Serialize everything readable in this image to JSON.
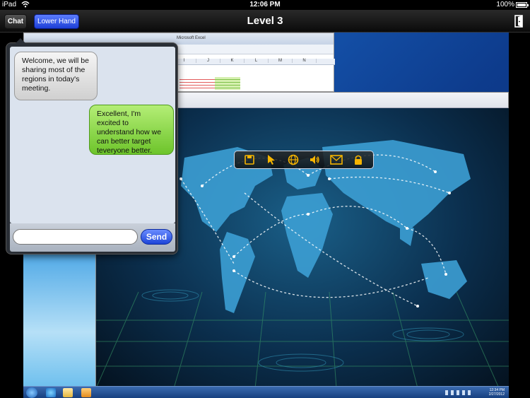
{
  "status_bar": {
    "carrier": "iPad",
    "wifi_icon": "wifi-icon",
    "time": "12:06 PM",
    "battery": "100%"
  },
  "navbar": {
    "chat_label": "Chat",
    "lower_hand_label": "Lower Hand",
    "title": "Level 3",
    "exit_icon": "exit-door-icon"
  },
  "shared_screen": {
    "excel_title": "Microsoft Excel",
    "excel_columns": [
      "I",
      "J",
      "K",
      "L",
      "M",
      "N"
    ],
    "toolbar_icons": [
      "save-icon",
      "pointer-icon",
      "globe-icon",
      "speaker-icon",
      "mail-icon",
      "lock-icon"
    ],
    "taskbar_clock_time": "12:34 PM",
    "taskbar_clock_date": "2/27/2012"
  },
  "chat": {
    "messages": [
      {
        "direction": "incoming",
        "text": "Welcome, we will be sharing most of the regions in today's meeting."
      },
      {
        "direction": "outgoing",
        "text": "Excellent, I'm excited to understand how we can better target teveryone better."
      }
    ],
    "input_placeholder": "",
    "send_label": "Send"
  },
  "colors": {
    "accent_blue": "#1d45d8",
    "outgoing_bubble": "#6dc42b",
    "toolbar_icon": "#f5b400"
  }
}
